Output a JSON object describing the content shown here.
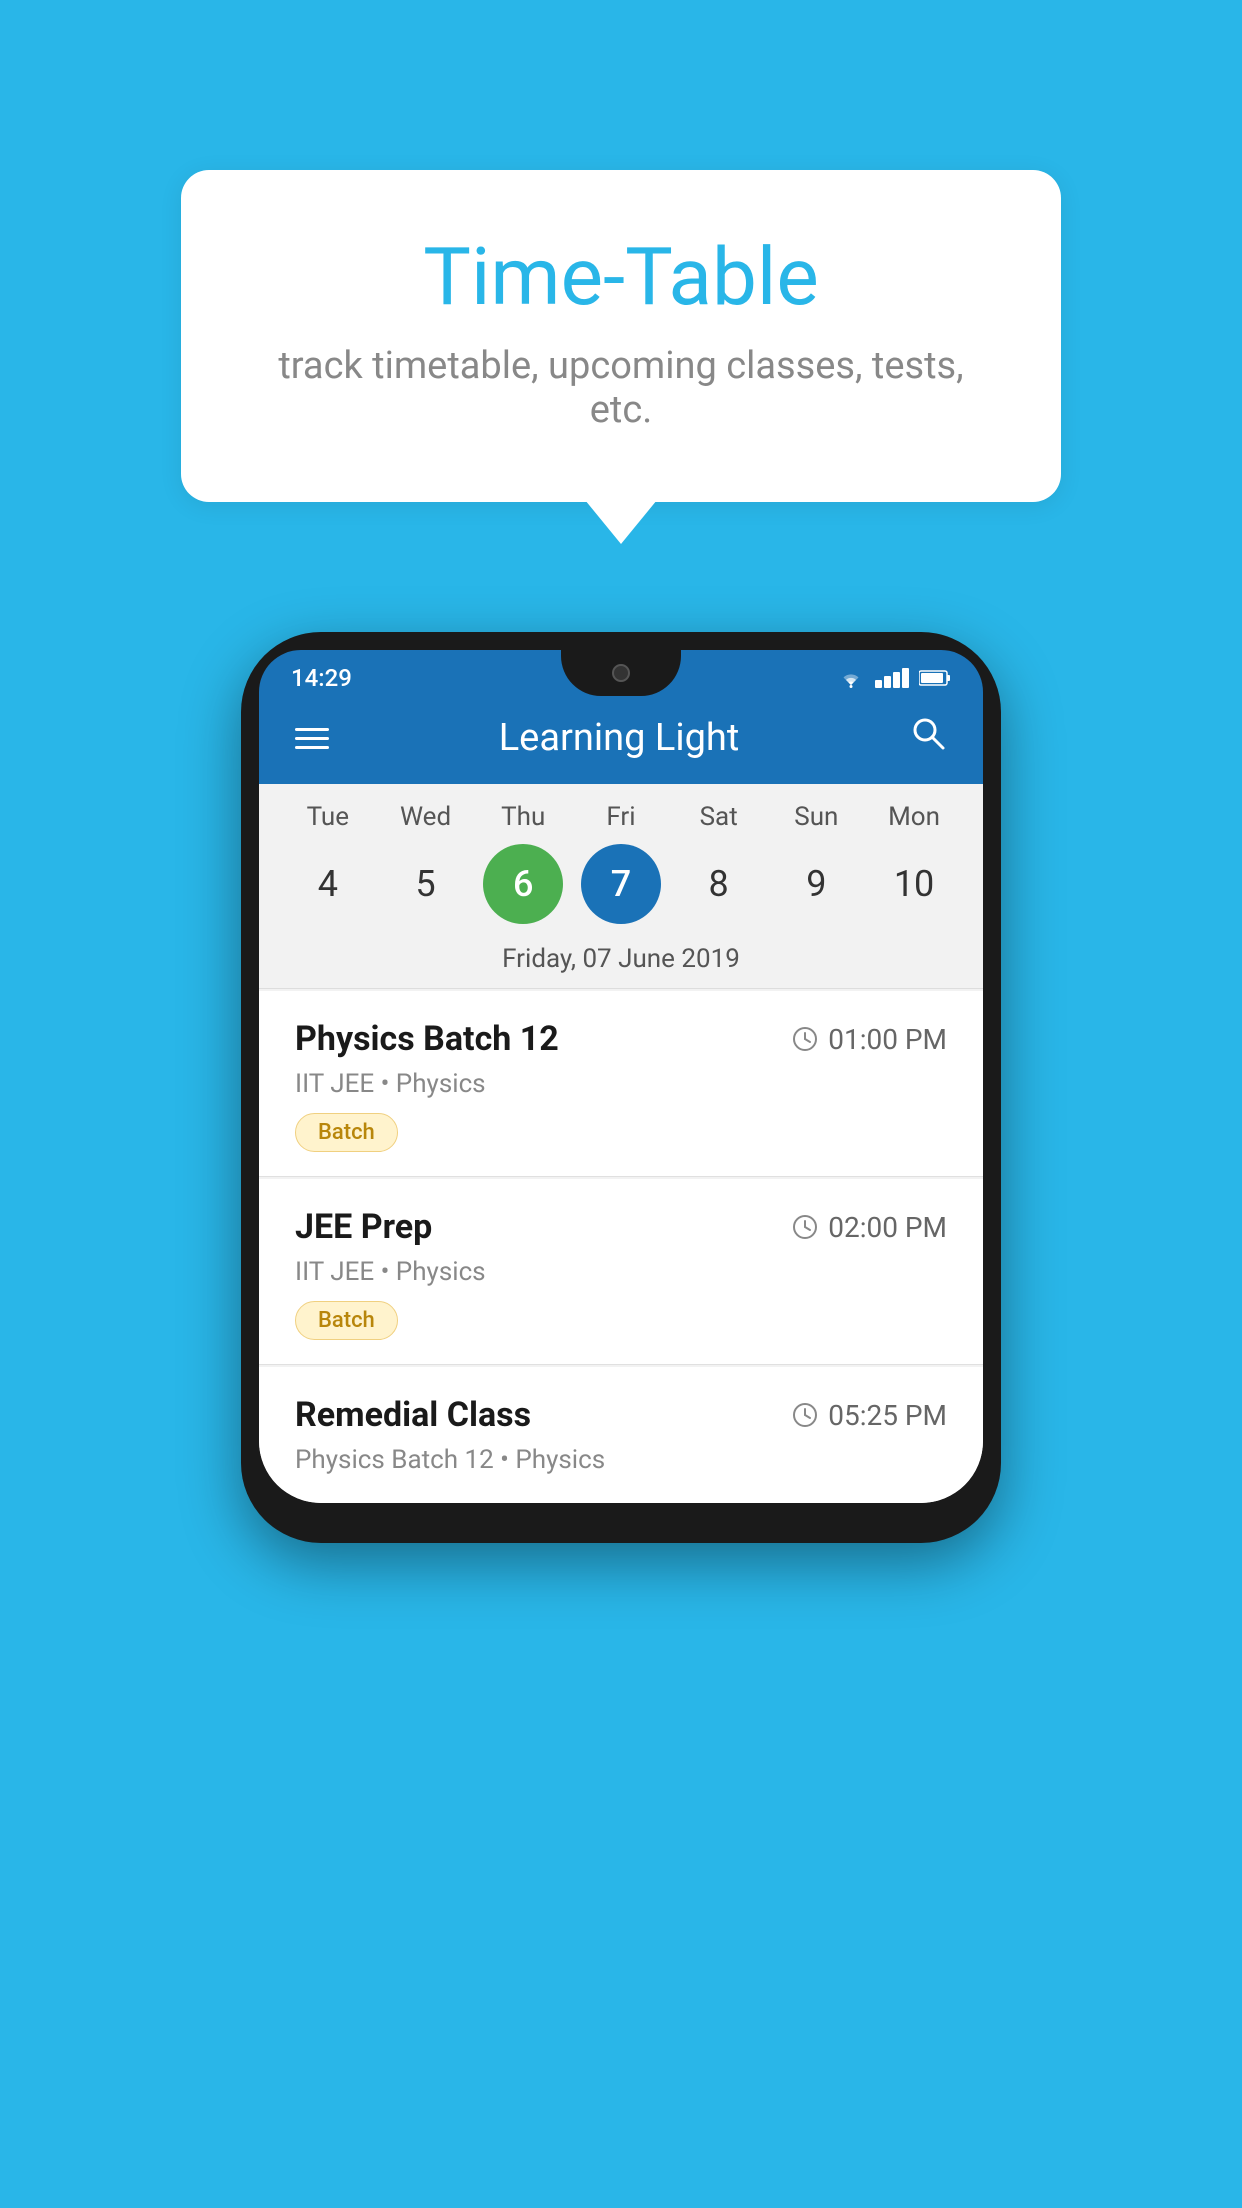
{
  "background_color": "#29B6E8",
  "tooltip": {
    "title": "Time-Table",
    "subtitle": "track timetable, upcoming classes, tests, etc."
  },
  "phone": {
    "status_bar": {
      "time": "14:29"
    },
    "app_header": {
      "title": "Learning Light"
    },
    "calendar": {
      "days": [
        {
          "name": "Tue",
          "num": "4",
          "state": "normal"
        },
        {
          "name": "Wed",
          "num": "5",
          "state": "normal"
        },
        {
          "name": "Thu",
          "num": "6",
          "state": "today"
        },
        {
          "name": "Fri",
          "num": "7",
          "state": "selected"
        },
        {
          "name": "Sat",
          "num": "8",
          "state": "normal"
        },
        {
          "name": "Sun",
          "num": "9",
          "state": "normal"
        },
        {
          "name": "Mon",
          "num": "10",
          "state": "normal"
        }
      ],
      "selected_date_label": "Friday, 07 June 2019"
    },
    "classes": [
      {
        "title": "Physics Batch 12",
        "time": "01:00 PM",
        "subtitle": "IIT JEE • Physics",
        "badge": "Batch"
      },
      {
        "title": "JEE Prep",
        "time": "02:00 PM",
        "subtitle": "IIT JEE • Physics",
        "badge": "Batch"
      },
      {
        "title": "Remedial Class",
        "time": "05:25 PM",
        "subtitle": "Physics Batch 12 • Physics",
        "badge": null
      }
    ]
  },
  "icons": {
    "hamburger": "☰",
    "search": "🔍",
    "clock": "🕐"
  }
}
